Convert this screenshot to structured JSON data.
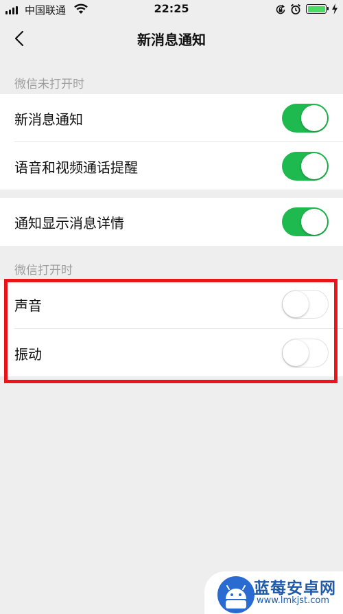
{
  "status_bar": {
    "carrier": "中国联通",
    "time": "22:25"
  },
  "nav": {
    "title": "新消息通知"
  },
  "sections": {
    "closed_caption": "微信未打开时",
    "open_caption": "微信打开时"
  },
  "rows": {
    "new_message": {
      "label": "新消息通知",
      "enabled": true
    },
    "voice_video": {
      "label": "语音和视频通话提醒",
      "enabled": true
    },
    "show_details": {
      "label": "通知显示消息详情",
      "enabled": true
    },
    "sound": {
      "label": "声音",
      "enabled": false
    },
    "vibrate": {
      "label": "振动",
      "enabled": false
    }
  },
  "colors": {
    "switch_on": "#1fba4f",
    "highlight": "#e8151b",
    "background": "#eeeeee"
  },
  "watermark": {
    "title": "蓝莓安卓网",
    "url": "www.lmkjst.com"
  }
}
